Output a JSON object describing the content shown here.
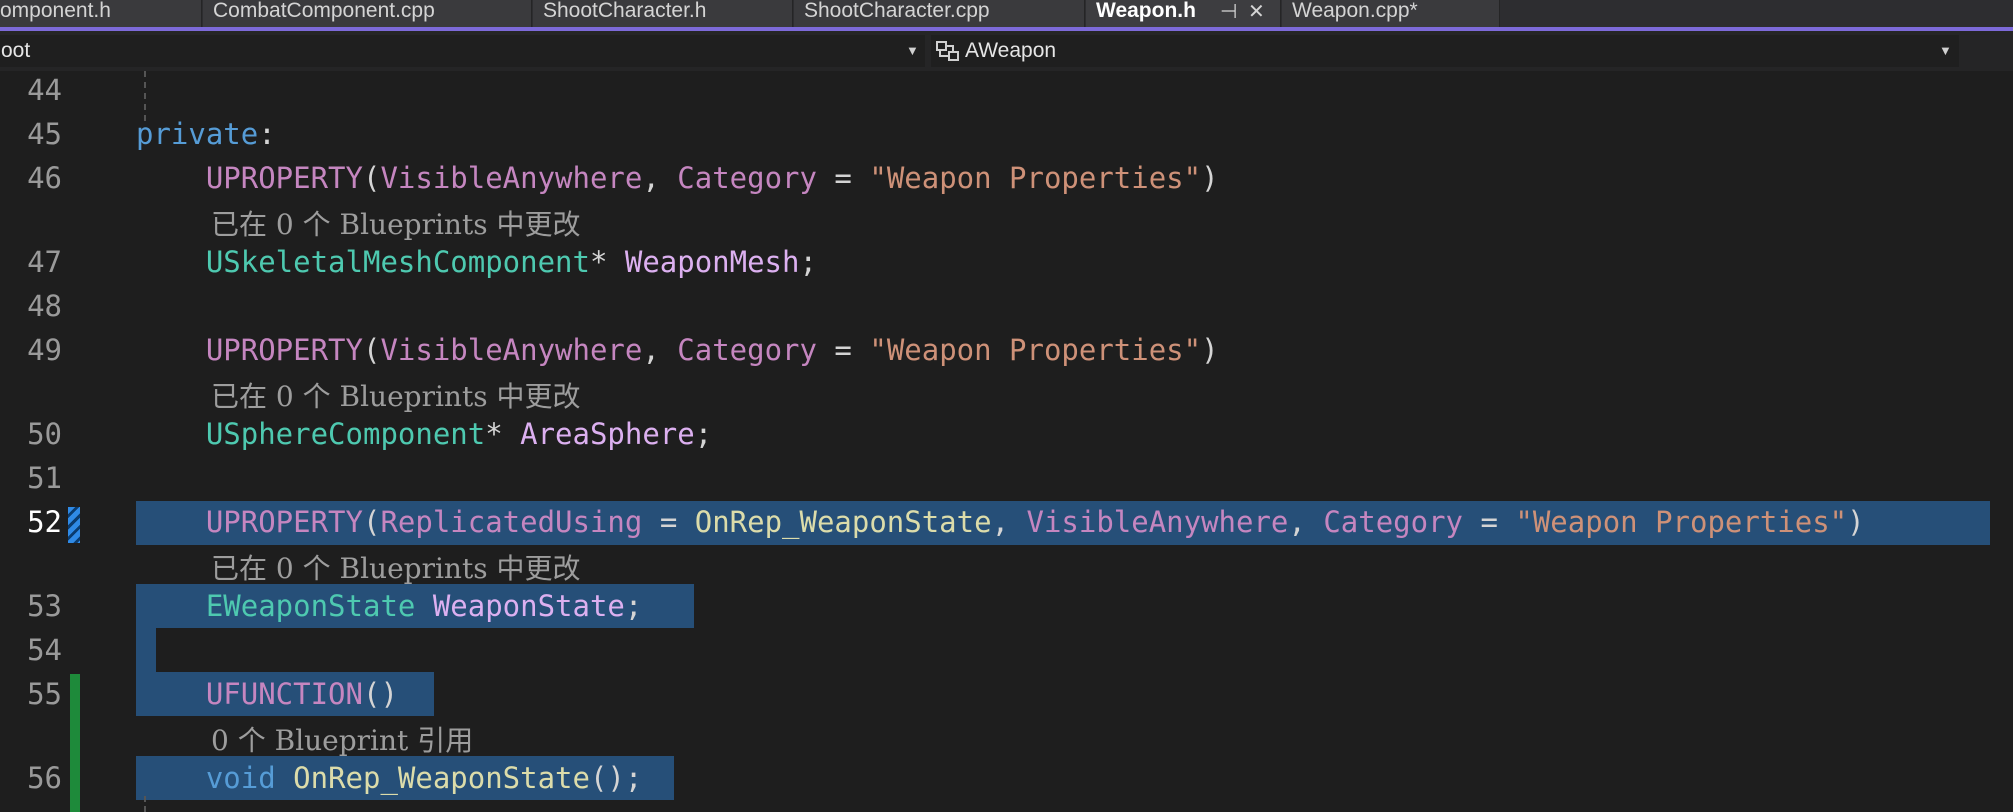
{
  "tabs": [
    {
      "label": "omponent.h"
    },
    {
      "label": "CombatComponent.cpp"
    },
    {
      "label": "ShootCharacter.h"
    },
    {
      "label": "ShootCharacter.cpp"
    },
    {
      "label": "Weapon.h",
      "active": true,
      "pin_icon": "pin-icon",
      "close_icon": "close-icon"
    },
    {
      "label": "Weapon.cpp*"
    }
  ],
  "navbar": {
    "scope": "oot",
    "member": "AWeapon",
    "member_icon": "class-member-icon"
  },
  "colors": {
    "keyword": "#569cd6",
    "macro": "#c586c0",
    "type": "#4ec9b0",
    "variable": "#dcb0f0",
    "string": "#ce9178",
    "function": "#dcdcaa",
    "selection": "#264f78",
    "accent": "#7d6ad9"
  },
  "lines": {
    "44": "44",
    "45": "45",
    "46": "46",
    "47": "47",
    "48": "48",
    "49": "49",
    "50": "50",
    "51": "51",
    "52": "52",
    "53": "53",
    "54": "54",
    "55": "55",
    "56": "56"
  },
  "code": {
    "l45": {
      "kw": "private",
      "colon": ":"
    },
    "l46": {
      "macro": "UPROPERTY",
      "open": "(",
      "spec": "VisibleAnywhere",
      "comma": ", ",
      "cat": "Category",
      "eq": " = ",
      "str": "\"Weapon Properties\"",
      "close": ")"
    },
    "l47": {
      "type": "USkeletalMeshComponent",
      "ptr": "* ",
      "var": "WeaponMesh",
      "semi": ";"
    },
    "l49": {
      "macro": "UPROPERTY",
      "open": "(",
      "spec": "VisibleAnywhere",
      "comma": ", ",
      "cat": "Category",
      "eq": " = ",
      "str": "\"Weapon Properties\"",
      "close": ")"
    },
    "l50": {
      "type": "USphereComponent",
      "ptr": "* ",
      "var": "AreaSphere",
      "semi": ";"
    },
    "l52": {
      "macro": "UPROPERTY",
      "open": "(",
      "spec1": "ReplicatedUsing",
      "eq1": " = ",
      "fn": "OnRep_WeaponState",
      "comma1": ", ",
      "spec2": "VisibleAnywhere",
      "comma2": ", ",
      "cat": "Category",
      "eq2": " = ",
      "str": "\"Weapon Properties\"",
      "close": ")"
    },
    "l53": {
      "type": "EWeaponState",
      "space": " ",
      "var": "WeaponState",
      "semi": ";"
    },
    "l55": {
      "macro": "UFUNCTION",
      "parens": "()"
    },
    "l56": {
      "kw": "void",
      "space": " ",
      "fn": "OnRep_WeaponState",
      "rest": "();"
    }
  },
  "codelens": {
    "l46": "已在 0 个 Blueprints 中更改",
    "l49": "已在 0 个 Blueprints 中更改",
    "l52": "已在 0 个 Blueprints 中更改",
    "l55": "0 个 Blueprint 引用"
  }
}
